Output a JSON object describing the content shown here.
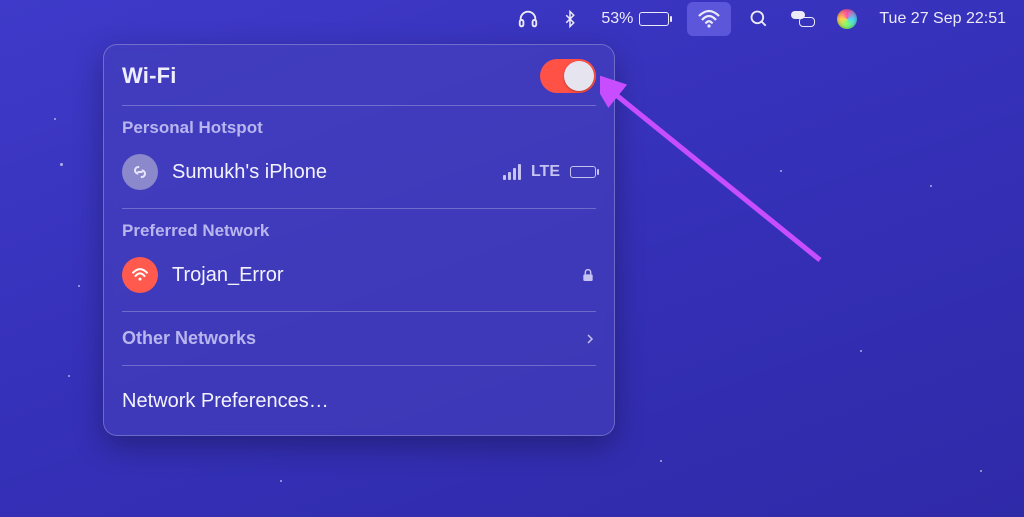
{
  "menubar": {
    "battery_percent": "53%",
    "battery_fill_pct": 53,
    "datetime": "Tue 27 Sep  22:51"
  },
  "wifi": {
    "title": "Wi-Fi",
    "toggle_on": true,
    "hotspot_section": "Personal Hotspot",
    "hotspot": {
      "name": "Sumukh's iPhone",
      "signal_label": "LTE"
    },
    "preferred_section": "Preferred Network",
    "preferred": {
      "name": "Trojan_Error",
      "locked": true
    },
    "other_label": "Other Networks",
    "prefs_label": "Network Preferences…"
  }
}
